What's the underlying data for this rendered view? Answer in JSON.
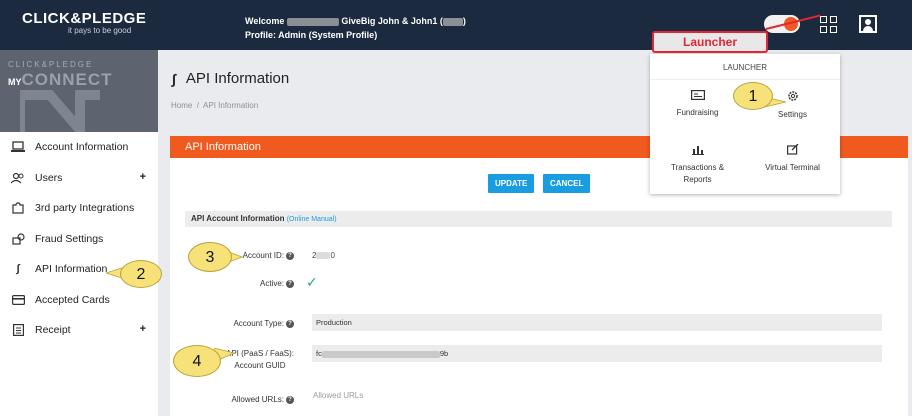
{
  "topbar": {
    "logo_text": "CLICK&PLEDGE",
    "logo_tagline": "it pays to be good",
    "welcome_prefix": "Welcome",
    "welcome_suffix": "GiveBig John & John1 (",
    "welcome_close": ")",
    "profile_line": "Profile: Admin (System Profile)",
    "toggle_color": "#f15a22"
  },
  "sidebar": {
    "hero_line1": "CLICK&PLEDGE",
    "hero_my": "MY",
    "hero_line2": "CONNECT",
    "items": [
      {
        "label": "Account Information",
        "icon": "laptop-icon",
        "expandable": false
      },
      {
        "label": "Users",
        "icon": "users-icon",
        "expandable": true
      },
      {
        "label": "3rd party Integrations",
        "icon": "puzzle-icon",
        "expandable": false
      },
      {
        "label": "Fraud Settings",
        "icon": "key-icon",
        "expandable": false
      },
      {
        "label": "API Information",
        "icon": "api-icon",
        "expandable": false,
        "active": true
      },
      {
        "label": "Accepted Cards",
        "icon": "card-icon",
        "expandable": false
      },
      {
        "label": "Receipt",
        "icon": "receipt-icon",
        "expandable": true
      }
    ],
    "plus": "+"
  },
  "main": {
    "title": "API Information",
    "breadcrumb_home": "Home",
    "breadcrumb_sep": "/",
    "breadcrumb_current": "API Information",
    "panel_title": "API Information",
    "update_label": "UPDATE",
    "cancel_label": "CANCEL",
    "section_title": "API Account Information",
    "section_link": "(Online Manual)",
    "fields": {
      "account_id_label": "Account ID:",
      "account_id_value_start": "2",
      "account_id_value_end": "0",
      "active_label": "Active:",
      "active_value": "✓",
      "account_type_label": "Account Type:",
      "account_type_value": "Production",
      "guid_label_1": "API (PaaS / FaaS):",
      "guid_label_2": "Account GUID",
      "guid_value_start": "fc",
      "guid_value_end": "9b",
      "allowed_urls_label": "Allowed URLs:",
      "allowed_urls_placeholder": "Allowed URLs"
    },
    "accent_color": "#f15a1f",
    "button_color": "#1a9de0"
  },
  "launcher": {
    "header": "LAUNCHER",
    "tiles": [
      {
        "label": "Fundraising",
        "icon": "fundraising-icon"
      },
      {
        "label": "Settings",
        "icon": "gear-icon"
      },
      {
        "label_line1": "Transactions &",
        "label_line2": "Reports",
        "icon": "bar-chart-icon"
      },
      {
        "label": "Virtual Terminal",
        "icon": "terminal-icon"
      }
    ]
  },
  "annotations": {
    "launcher_callout": "Launcher",
    "bubble_1": "1",
    "bubble_2": "2",
    "bubble_3": "3",
    "bubble_4": "4"
  }
}
